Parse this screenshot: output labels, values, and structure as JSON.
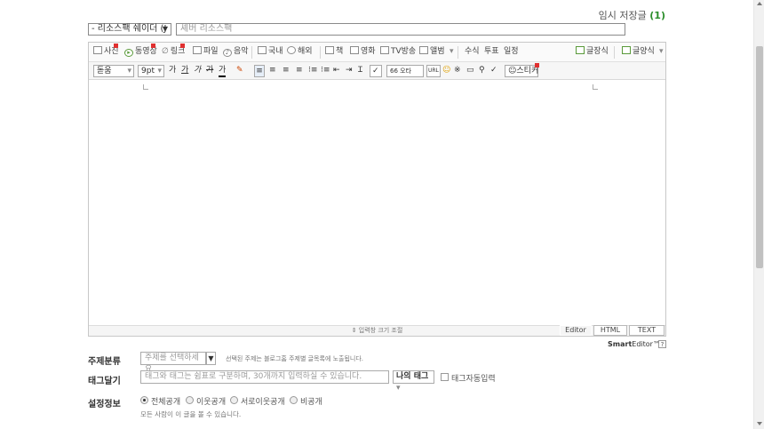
{
  "autosave": {
    "label": "임시 저장글",
    "count": "(1)"
  },
  "category_select": {
    "value": "- 리소스팩 쉐이더 (J"
  },
  "title_input": {
    "value": "셰버 리소스팩"
  },
  "toolbar_top": [
    {
      "id": "photo",
      "label": "사진",
      "icon": "photo-icon"
    },
    {
      "id": "video",
      "label": "동영상",
      "icon": "play-icon"
    },
    {
      "id": "link",
      "label": "링크",
      "icon": "link-icon"
    },
    {
      "id": "file",
      "label": "파일",
      "icon": "file-icon"
    },
    {
      "id": "music",
      "label": "음악",
      "icon": "music-icon"
    },
    {
      "id": "domestic",
      "label": "국내",
      "icon": "map-icon"
    },
    {
      "id": "overseas",
      "label": "해외",
      "icon": "globe-icon"
    },
    {
      "id": "book",
      "label": "책",
      "icon": "book-icon"
    },
    {
      "id": "movie",
      "label": "영화",
      "icon": "film-icon"
    },
    {
      "id": "tv",
      "label": "TV방송",
      "icon": "tv-icon"
    },
    {
      "id": "album",
      "label": "앨범",
      "icon": "album-icon"
    },
    {
      "id": "formula",
      "label": "수식",
      "icon": ""
    },
    {
      "id": "vote",
      "label": "투표",
      "icon": ""
    },
    {
      "id": "schedule",
      "label": "일정",
      "icon": ""
    },
    {
      "id": "post_style",
      "label": "글장식",
      "icon": "paint-icon"
    },
    {
      "id": "template",
      "label": "글양식",
      "icon": "template-icon"
    }
  ],
  "toolbar_format": {
    "font": "돋움",
    "size": "9pt",
    "bold": "가",
    "underline": "가",
    "italic": "가",
    "strike": "가",
    "fontcolor": "가",
    "quote": "66 오타",
    "spell": "맞춤",
    "sticker": "스티커"
  },
  "resize_label": "⇕ 입력창 크기 조절",
  "mode_tabs": [
    "Editor",
    "HTML",
    "TEXT"
  ],
  "brand": {
    "bold": "Smart",
    "rest": "Editor™"
  },
  "help": "?",
  "topic": {
    "label": "주제분류",
    "placeholder": "주제를 선택하세요",
    "hint": "선택된 주제는 블로그홈 주제별 글목록에 노출됩니다."
  },
  "tags": {
    "label": "태그달기",
    "placeholder": "태그와 태그는 쉼표로 구분하며, 30개까지 입력하실 수 있습니다.",
    "my_tag": "나의 태그",
    "auto_input": "태그자동입력"
  },
  "settings": {
    "label": "설정정보",
    "options": [
      "전체공개",
      "이웃공개",
      "서로이웃공개",
      "비공개"
    ],
    "selected": "전체공개",
    "desc": "모든 사람이 이 글을 볼 수 있습니다."
  }
}
